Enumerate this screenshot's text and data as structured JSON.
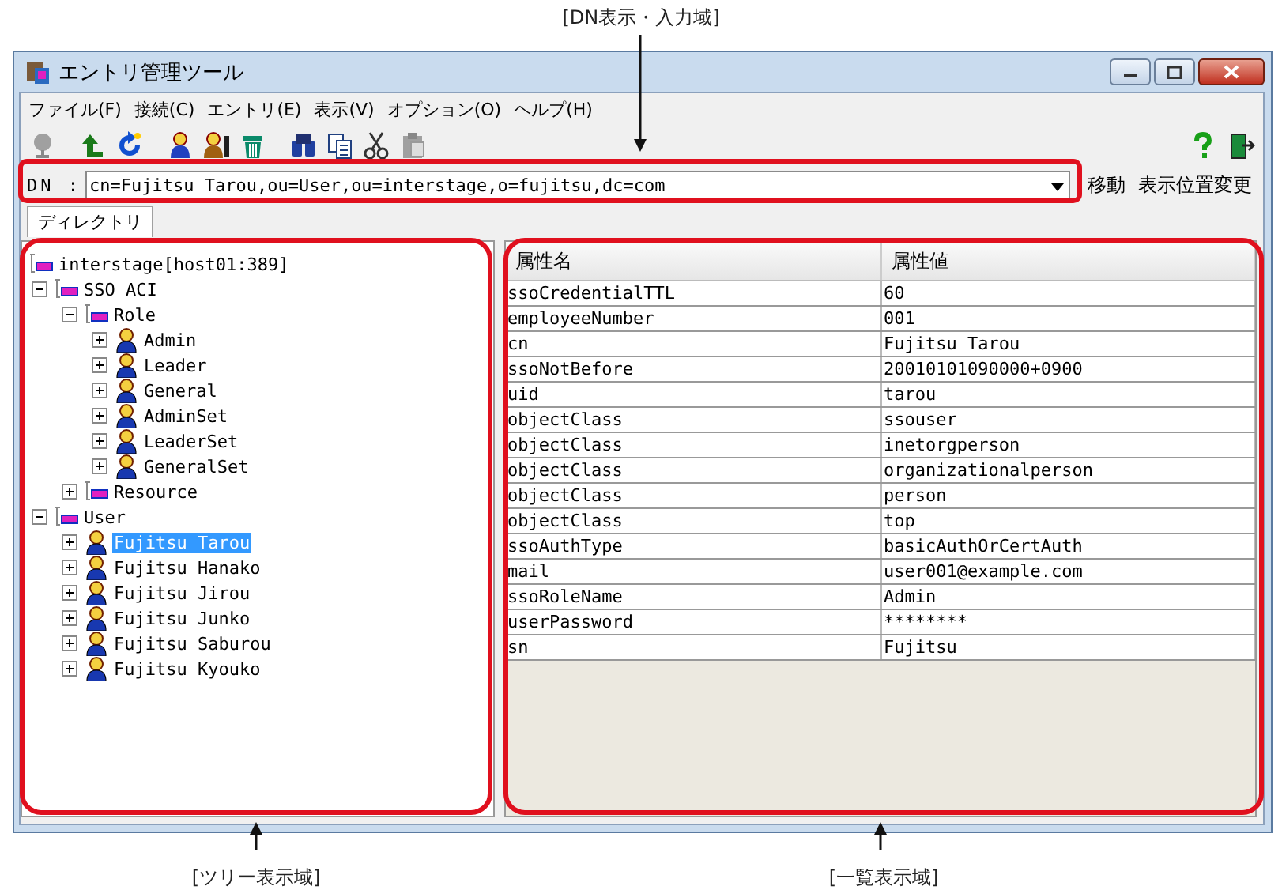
{
  "annotations": {
    "dn_area": "[DN表示・入力域]",
    "tree_area": "[ツリー表示域]",
    "list_area": "[一覧表示域]"
  },
  "window": {
    "title": "エントリ管理ツール"
  },
  "menu": [
    "ファイル(F)",
    "接続(C)",
    "エントリ(E)",
    "表示(V)",
    "オプション(O)",
    "ヘルプ(H)"
  ],
  "toolbar": [
    {
      "kind": "connect",
      "disabled": true
    },
    {
      "kind": "up",
      "disabled": false
    },
    {
      "kind": "refresh",
      "disabled": false
    },
    {
      "kind": "add-person",
      "disabled": false
    },
    {
      "kind": "edit-person",
      "disabled": false
    },
    {
      "kind": "delete",
      "disabled": false
    },
    {
      "kind": "search",
      "disabled": false
    },
    {
      "kind": "copy",
      "disabled": false
    },
    {
      "kind": "cut",
      "disabled": false
    },
    {
      "kind": "paste",
      "disabled": true
    }
  ],
  "toolbar_right": [
    {
      "kind": "help",
      "disabled": false
    },
    {
      "kind": "exit",
      "disabled": false
    }
  ],
  "dn": {
    "label": "DN :",
    "value": "cn=Fujitsu Tarou,ou=User,ou=interstage,o=fujitsu,dc=com"
  },
  "dn_buttons": [
    "移動",
    "表示位置変更"
  ],
  "tabs": [
    {
      "label": "ディレクトリ",
      "selected": true
    }
  ],
  "tree": [
    {
      "label": "interstage[host01:389]",
      "kind": "container",
      "selected": false,
      "children": [
        {
          "label": "SSO ACI",
          "kind": "container",
          "expanded": true,
          "selected": false,
          "children": [
            {
              "label": "Role",
              "kind": "container",
              "expanded": true,
              "selected": false,
              "children": [
                {
                  "label": "Admin",
                  "kind": "person",
                  "expanded": false,
                  "selected": false
                },
                {
                  "label": "Leader",
                  "kind": "person",
                  "expanded": false,
                  "selected": false
                },
                {
                  "label": "General",
                  "kind": "person",
                  "expanded": false,
                  "selected": false
                },
                {
                  "label": "AdminSet",
                  "kind": "person",
                  "expanded": false,
                  "selected": false
                },
                {
                  "label": "LeaderSet",
                  "kind": "person",
                  "expanded": false,
                  "selected": false
                },
                {
                  "label": "GeneralSet",
                  "kind": "person",
                  "expanded": false,
                  "selected": false
                }
              ]
            },
            {
              "label": "Resource",
              "kind": "container",
              "expanded": false,
              "selected": false
            }
          ]
        },
        {
          "label": "User",
          "kind": "container",
          "expanded": true,
          "selected": false,
          "children": [
            {
              "label": "Fujitsu Tarou",
              "kind": "person",
              "expanded": false,
              "selected": true
            },
            {
              "label": "Fujitsu Hanako",
              "kind": "person",
              "expanded": false,
              "selected": false
            },
            {
              "label": "Fujitsu Jirou",
              "kind": "person",
              "expanded": false,
              "selected": false
            },
            {
              "label": "Fujitsu Junko",
              "kind": "person",
              "expanded": false,
              "selected": false
            },
            {
              "label": "Fujitsu Saburou",
              "kind": "person",
              "expanded": false,
              "selected": false
            },
            {
              "label": "Fujitsu Kyouko",
              "kind": "person",
              "expanded": false,
              "selected": false
            }
          ]
        }
      ]
    }
  ],
  "table": {
    "columns": [
      "属性名",
      "属性値"
    ],
    "rows": [
      [
        "ssoCredentialTTL",
        "60"
      ],
      [
        "employeeNumber",
        "001"
      ],
      [
        "cn",
        "Fujitsu Tarou"
      ],
      [
        "ssoNotBefore",
        "20010101090000+0900"
      ],
      [
        "uid",
        "tarou"
      ],
      [
        "objectClass",
        "ssouser"
      ],
      [
        "objectClass",
        "inetorgperson"
      ],
      [
        "objectClass",
        "organizationalperson"
      ],
      [
        "objectClass",
        "person"
      ],
      [
        "objectClass",
        "top"
      ],
      [
        "ssoAuthType",
        "basicAuthOrCertAuth"
      ],
      [
        "mail",
        "user001@example.com"
      ],
      [
        "ssoRoleName",
        "Admin"
      ],
      [
        "userPassword",
        "********"
      ],
      [
        "sn",
        "Fujitsu"
      ]
    ]
  }
}
